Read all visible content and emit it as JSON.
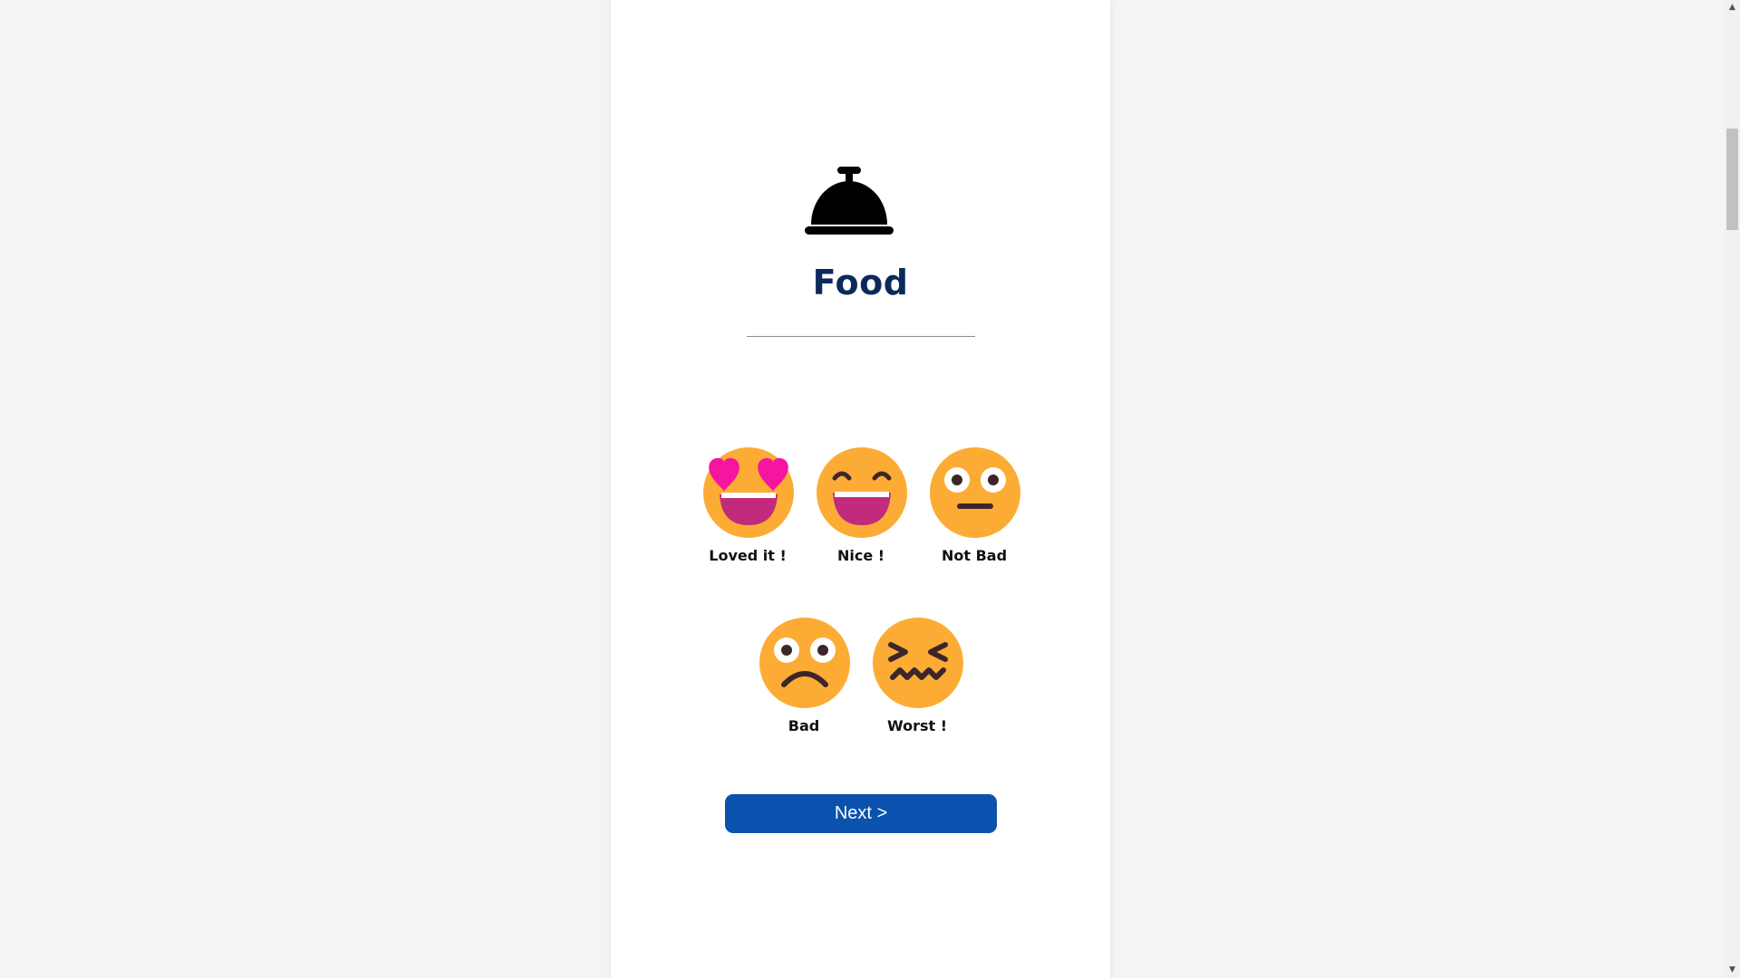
{
  "section": {
    "icon": "service-bell-icon",
    "title": "Food"
  },
  "ratings": [
    {
      "label": "Loved it !",
      "icon": "heart-eyes-face-icon"
    },
    {
      "label": "Nice !",
      "icon": "grinning-face-icon"
    },
    {
      "label": "Not Bad",
      "icon": "neutral-face-icon"
    },
    {
      "label": "Bad",
      "icon": "frowning-face-icon"
    },
    {
      "label": "Worst !",
      "icon": "confounded-face-icon"
    }
  ],
  "next_button": {
    "label": "Next >"
  },
  "colors": {
    "title": "#0b2a5b",
    "button": "#0b52ae",
    "face": "#fcac35",
    "heart": "#f5159e",
    "mouth": "#c12a7d",
    "feature": "#3d2629"
  },
  "scrollbar": {
    "up_arrow": "▲",
    "down_arrow": "▼"
  }
}
